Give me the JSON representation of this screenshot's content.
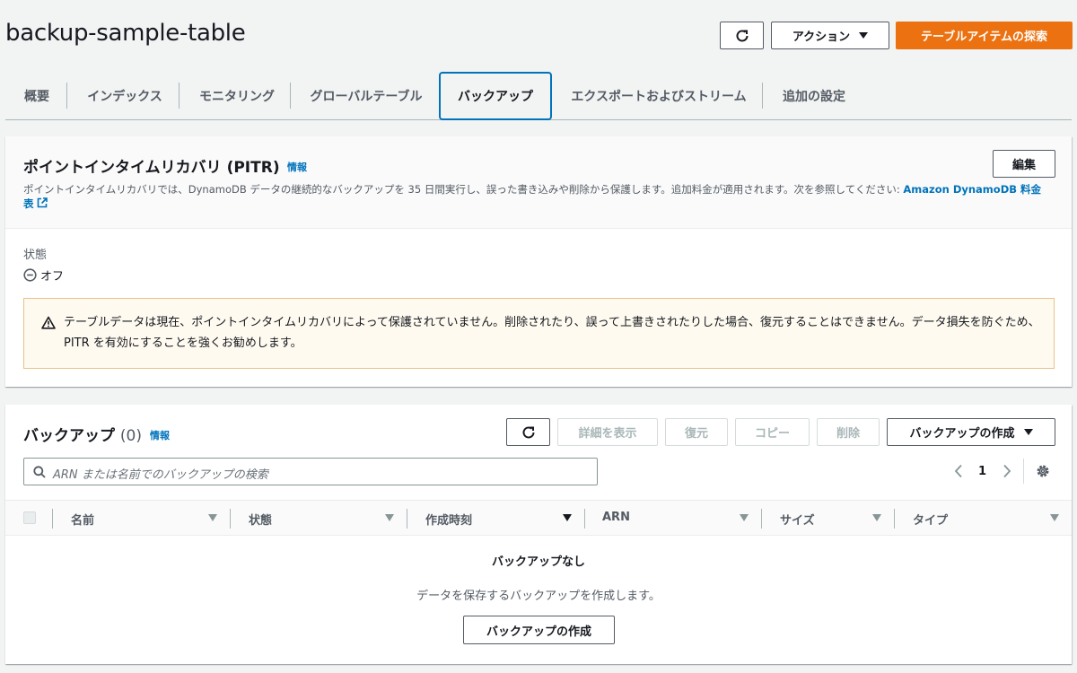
{
  "header": {
    "title": "backup-sample-table",
    "actions_label": "アクション",
    "explore_label": "テーブルアイテムの探索"
  },
  "tabs": [
    {
      "label": "概要"
    },
    {
      "label": "インデックス"
    },
    {
      "label": "モニタリング"
    },
    {
      "label": "グローバルテーブル"
    },
    {
      "label": "バックアップ",
      "active": true
    },
    {
      "label": "エクスポートおよびストリーム"
    },
    {
      "label": "追加の設定"
    }
  ],
  "pitr": {
    "title": "ポイントインタイムリカバリ (PITR)",
    "info": "情報",
    "edit_label": "編集",
    "description": "ポイントインタイムリカバリでは、DynamoDB データの継続的なバックアップを 35 日間実行し、誤った書き込みや削除から保護します。追加料金が適用されます。次を参照してください: ",
    "pricing_link_line1": "Amazon DynamoDB 料金",
    "pricing_link_line2": "表",
    "status_label": "状態",
    "status_value": "オフ",
    "warning": "テーブルデータは現在、ポイントインタイムリカバリによって保護されていません。削除されたり、誤って上書きされたりした場合、復元することはできません。データ損失を防ぐため、PITR を有効にすることを強くお勧めします。"
  },
  "backups": {
    "title": "バックアップ",
    "count": "(0)",
    "info": "情報",
    "view_details_label": "詳細を表示",
    "restore_label": "復元",
    "copy_label": "コピー",
    "delete_label": "削除",
    "create_label": "バックアップの作成",
    "search_placeholder": "ARN または名前でのバックアップの検索",
    "page_number": "1",
    "columns": [
      "名前",
      "状態",
      "作成時刻",
      "ARN",
      "サイズ",
      "タイプ"
    ],
    "empty_title": "バックアップなし",
    "empty_desc": "データを保存するバックアップを作成します。",
    "empty_create_label": "バックアップの作成"
  },
  "colors": {
    "primary": "#ec7211",
    "link": "#0073bb",
    "warning_bg": "#fffaf0"
  }
}
